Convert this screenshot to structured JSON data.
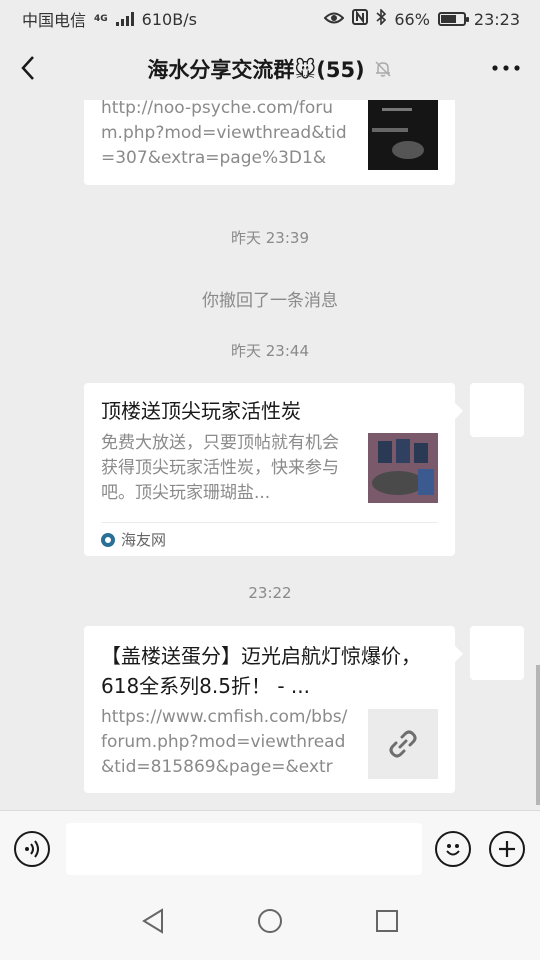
{
  "status_bar": {
    "carrier": "中国电信",
    "network": "4G",
    "speed": "610B/s",
    "battery_percent": "66%",
    "battery_level": 0.66,
    "time": "23:23"
  },
  "header": {
    "title": "海水分享交流群🐭(55)",
    "back_icon": "chevron-left-icon",
    "mute_icon": "bell-off-icon",
    "more_icon": "more-horizontal-icon"
  },
  "messages": {
    "link_card_1": {
      "desc": "http://noo-psyche.com/forum.php?mod=viewthread&tid=307&extra=page%3D1&m..."
    },
    "timestamp_1": "昨天 23:39",
    "recall_notice": "你撤回了一条消息",
    "timestamp_2": "昨天 23:44",
    "link_card_2": {
      "title": "顶楼送顶尖玩家活性炭",
      "desc": "免费大放送，只要顶帖就有机会获得顶尖玩家活性炭，快来参与吧。顶尖玩家珊瑚盐...",
      "source": "海友网"
    },
    "timestamp_3": "23:22",
    "link_card_3": {
      "title": "【盖楼送蛋分】迈光启航灯惊爆价，618全系列8.5折！ - ...",
      "desc": "https://www.cmfish.com/bbs/forum.php?mod=viewthread&tid=815869&page=&extra..."
    }
  },
  "input_bar": {
    "voice_icon": "voice-icon",
    "emoji_icon": "emoji-icon",
    "plus_icon": "plus-icon"
  },
  "nav_bar": {
    "back_icon": "nav-back-icon",
    "home_icon": "nav-home-icon",
    "recents_icon": "nav-recents-icon"
  },
  "colors": {
    "background": "#ededed",
    "card": "#ffffff",
    "muted_text": "#8a8a8a"
  }
}
